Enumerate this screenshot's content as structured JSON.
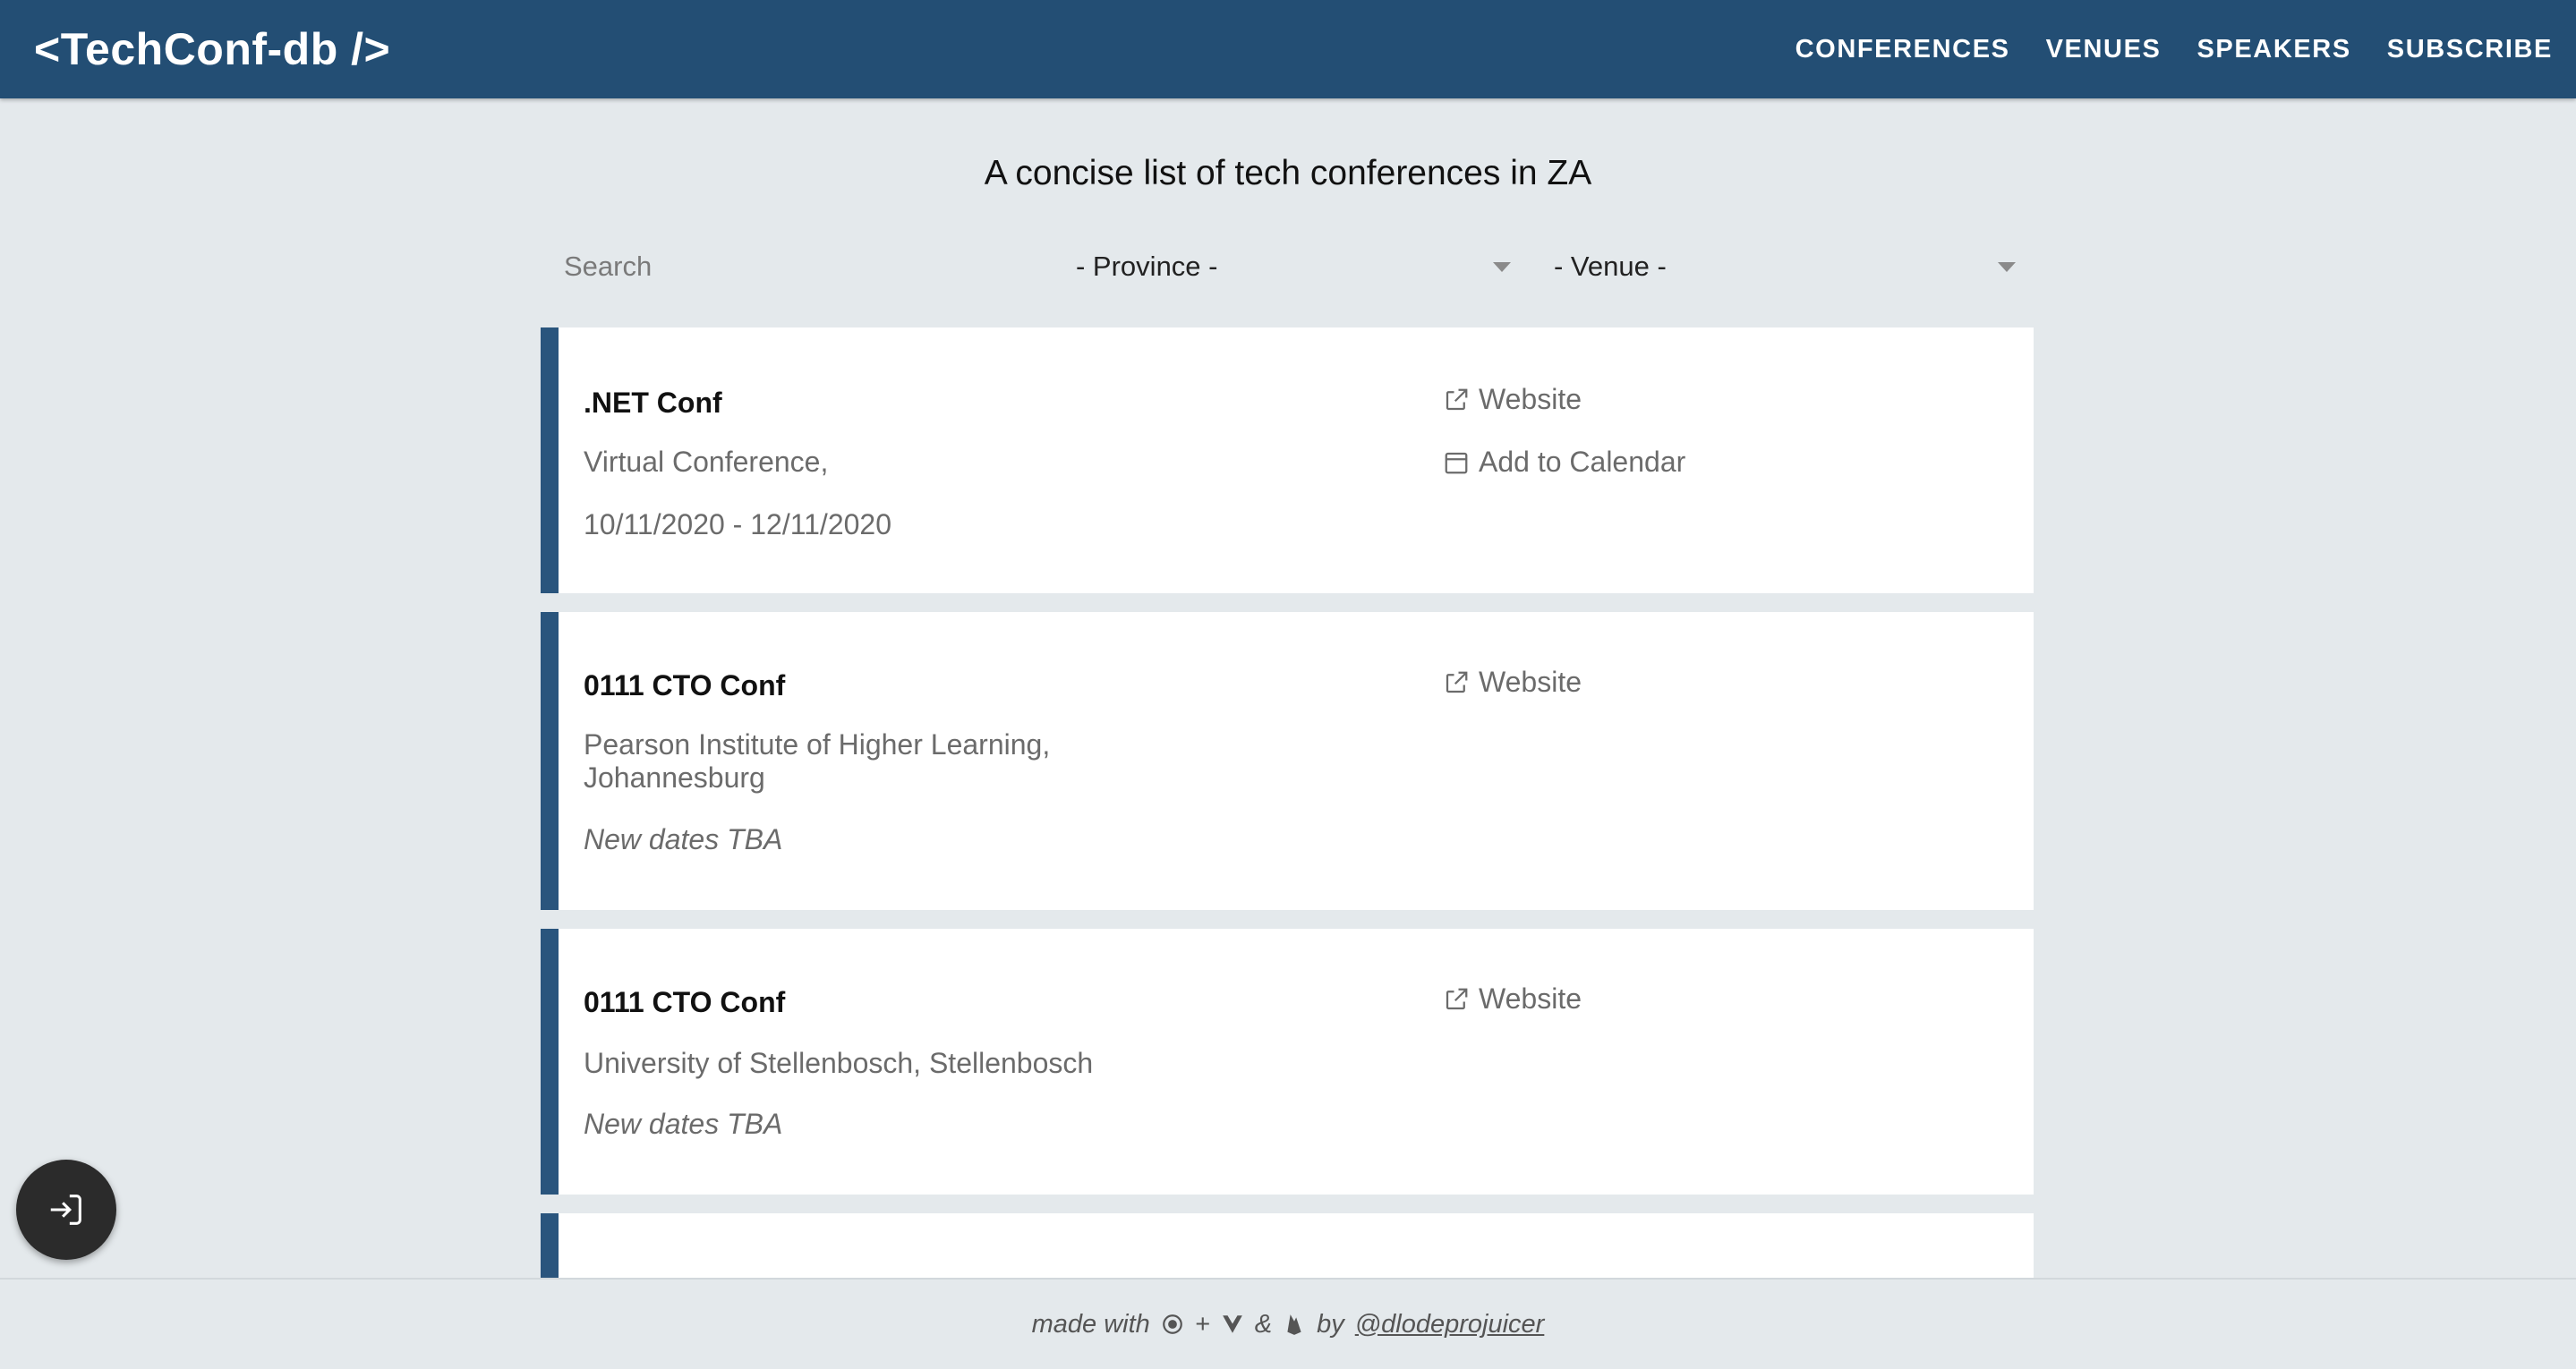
{
  "navbar": {
    "brand": "<TechConf-db />",
    "links": [
      "CONFERENCES",
      "VENUES",
      "SPEAKERS",
      "SUBSCRIBE"
    ]
  },
  "tagline": "A concise list of tech conferences in ZA",
  "filters": {
    "search_placeholder": "Search",
    "province_selected": "- Province -",
    "venue_selected": "- Venue -"
  },
  "conferences": [
    {
      "name": ".NET Conf",
      "venue": "Virtual Conference,",
      "dates": "10/11/2020 - 12/11/2020",
      "website_label": "Website",
      "calendar_label": "Add to Calendar"
    },
    {
      "name": "0111 CTO Conf",
      "venue_line1": "Pearson Institute of Higher Learning,",
      "venue_line2": "Johannesburg",
      "dates": "New dates TBA",
      "website_label": "Website"
    },
    {
      "name": "0111 CTO Conf",
      "venue": "University of Stellenbosch, Stellenbosch",
      "dates": "New dates TBA",
      "website_label": "Website"
    }
  ],
  "footer": {
    "made_with": "made with",
    "plus": "+",
    "amp": "&",
    "by": "by",
    "author": "@dlodeprojuicer"
  },
  "icons": {
    "external_link": "external-link-icon",
    "calendar": "calendar-icon",
    "login": "login-icon"
  },
  "colors": {
    "navbar": "#234e74",
    "accent_bar": "#2a557d",
    "background": "#e4e9ec"
  }
}
